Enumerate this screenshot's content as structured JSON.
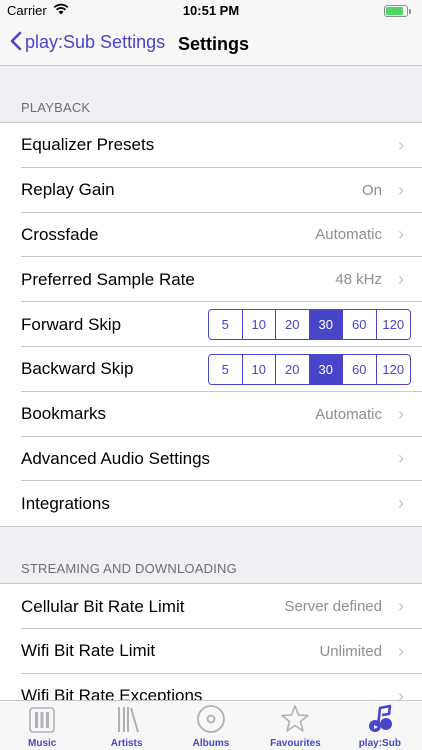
{
  "status_bar": {
    "carrier": "Carrier",
    "time": "10:51 PM",
    "battery_level": 0.85
  },
  "nav": {
    "back_label": "play:Sub Settings",
    "title": "Settings"
  },
  "sections": [
    {
      "header": "PLAYBACK",
      "rows": [
        {
          "label": "Equalizer Presets",
          "value": ""
        },
        {
          "label": "Replay Gain",
          "value": "On"
        },
        {
          "label": "Crossfade",
          "value": "Automatic"
        },
        {
          "label": "Preferred Sample Rate",
          "value": "48 kHz"
        },
        {
          "label": "Forward Skip",
          "segments": [
            "5",
            "10",
            "20",
            "30",
            "60",
            "120"
          ],
          "selected": "30"
        },
        {
          "label": "Backward Skip",
          "segments": [
            "5",
            "10",
            "20",
            "30",
            "60",
            "120"
          ],
          "selected": "30"
        },
        {
          "label": "Bookmarks",
          "value": "Automatic"
        },
        {
          "label": "Advanced Audio Settings",
          "value": ""
        },
        {
          "label": "Integrations",
          "value": ""
        }
      ]
    },
    {
      "header": "STREAMING AND DOWNLOADING",
      "rows": [
        {
          "label": "Cellular Bit Rate Limit",
          "value": "Server defined"
        },
        {
          "label": "Wifi Bit Rate Limit",
          "value": "Unlimited"
        },
        {
          "label": "Wifi Bit Rate Exceptions",
          "value": ""
        }
      ]
    }
  ],
  "tabs": [
    {
      "label": "Music",
      "icon": "music-library-icon"
    },
    {
      "label": "Artists",
      "icon": "artists-icon"
    },
    {
      "label": "Albums",
      "icon": "album-disc-icon"
    },
    {
      "label": "Favourites",
      "icon": "star-icon"
    },
    {
      "label": "play:Sub",
      "icon": "playsub-logo-icon",
      "active": true
    }
  ],
  "colors": {
    "accent": "#4845c8",
    "background": "#efeff4",
    "secondary_text": "#8e8e93"
  }
}
